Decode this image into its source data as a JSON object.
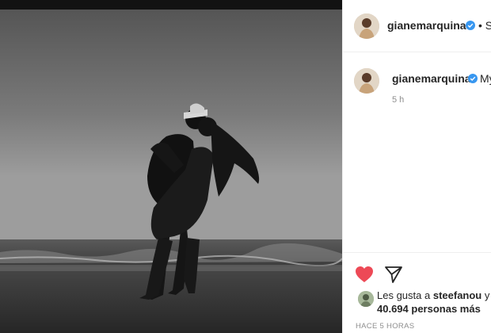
{
  "post": {
    "image_alt": "",
    "owner": {
      "username": "gianemarquina",
      "verified": true,
      "follow_separator": "•",
      "follow_label": "S"
    },
    "caption": {
      "username": "gianemarquina",
      "text": "My",
      "time": "5 h"
    },
    "actions": {
      "like_icon": "heart-filled-icon",
      "share_icon": "paper-plane-icon"
    },
    "likes": {
      "prefix": "Les gusta a",
      "liker": "steefanou",
      "conjunction": "y",
      "count_text": "40.694 personas más"
    },
    "posted_ago": "HACE 5 HORAS"
  },
  "colors": {
    "like_red": "#ed4956",
    "verified_blue": "#3897f0",
    "muted_text": "#8e8e8e",
    "primary_text": "#262626"
  }
}
